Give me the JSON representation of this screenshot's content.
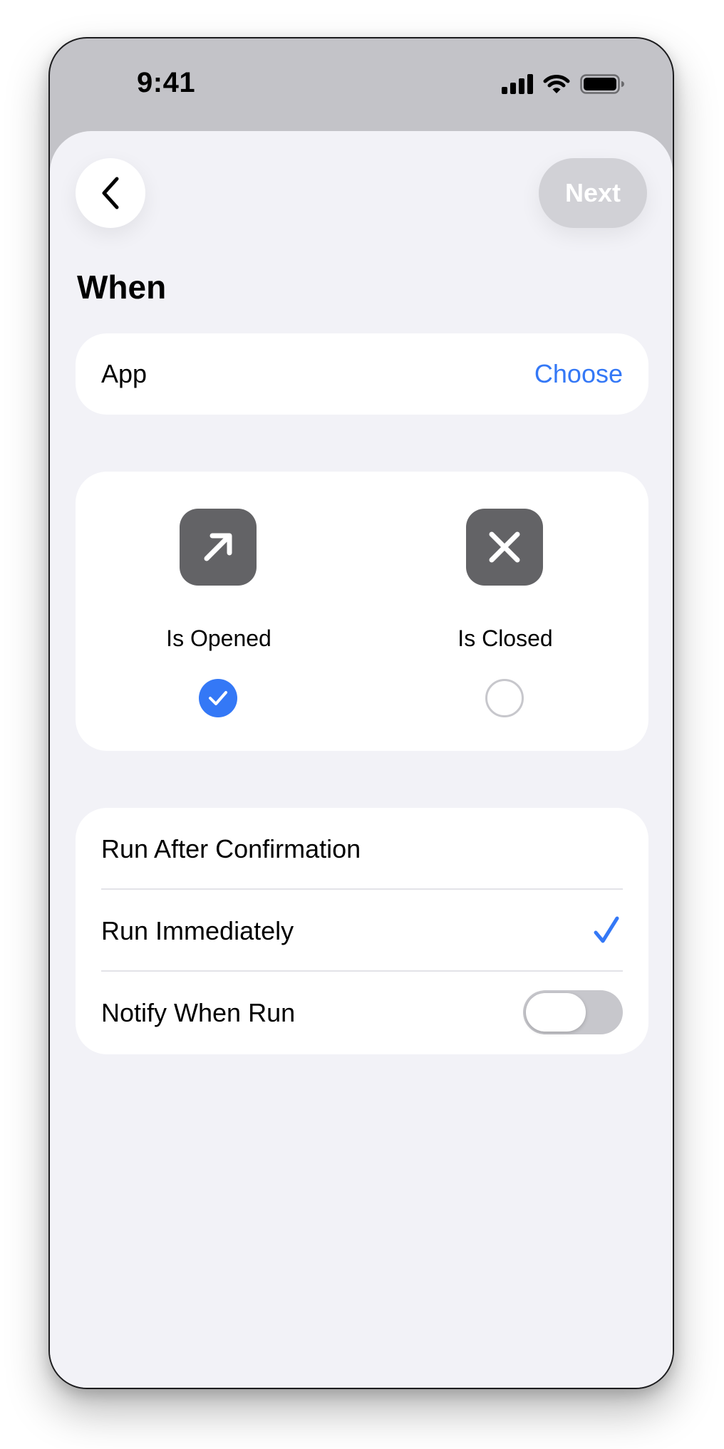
{
  "status_bar": {
    "time": "9:41",
    "icons": [
      "cellular-signal-icon",
      "wifi-icon",
      "battery-icon"
    ]
  },
  "nav": {
    "back_icon": "chevron-left-icon",
    "next_label": "Next"
  },
  "section": {
    "title": "When"
  },
  "app_row": {
    "label": "App",
    "action": "Choose"
  },
  "options": [
    {
      "label": "Is Opened",
      "icon": "arrow-up-right-icon",
      "selected": true
    },
    {
      "label": "Is Closed",
      "icon": "xmark-icon",
      "selected": false
    }
  ],
  "run_settings": {
    "rows": [
      {
        "label": "Run After Confirmation",
        "checked": false
      },
      {
        "label": "Run Immediately",
        "checked": true
      },
      {
        "label": "Notify When Run",
        "toggle_on": false
      }
    ]
  },
  "colors": {
    "accent": "#3478f6",
    "background": "#f2f2f7",
    "status_bar_bg": "#c3c3c8",
    "icon_tile": "#636366",
    "next_disabled": "#d1d1d6",
    "toggle_off": "#c7c7cc"
  }
}
